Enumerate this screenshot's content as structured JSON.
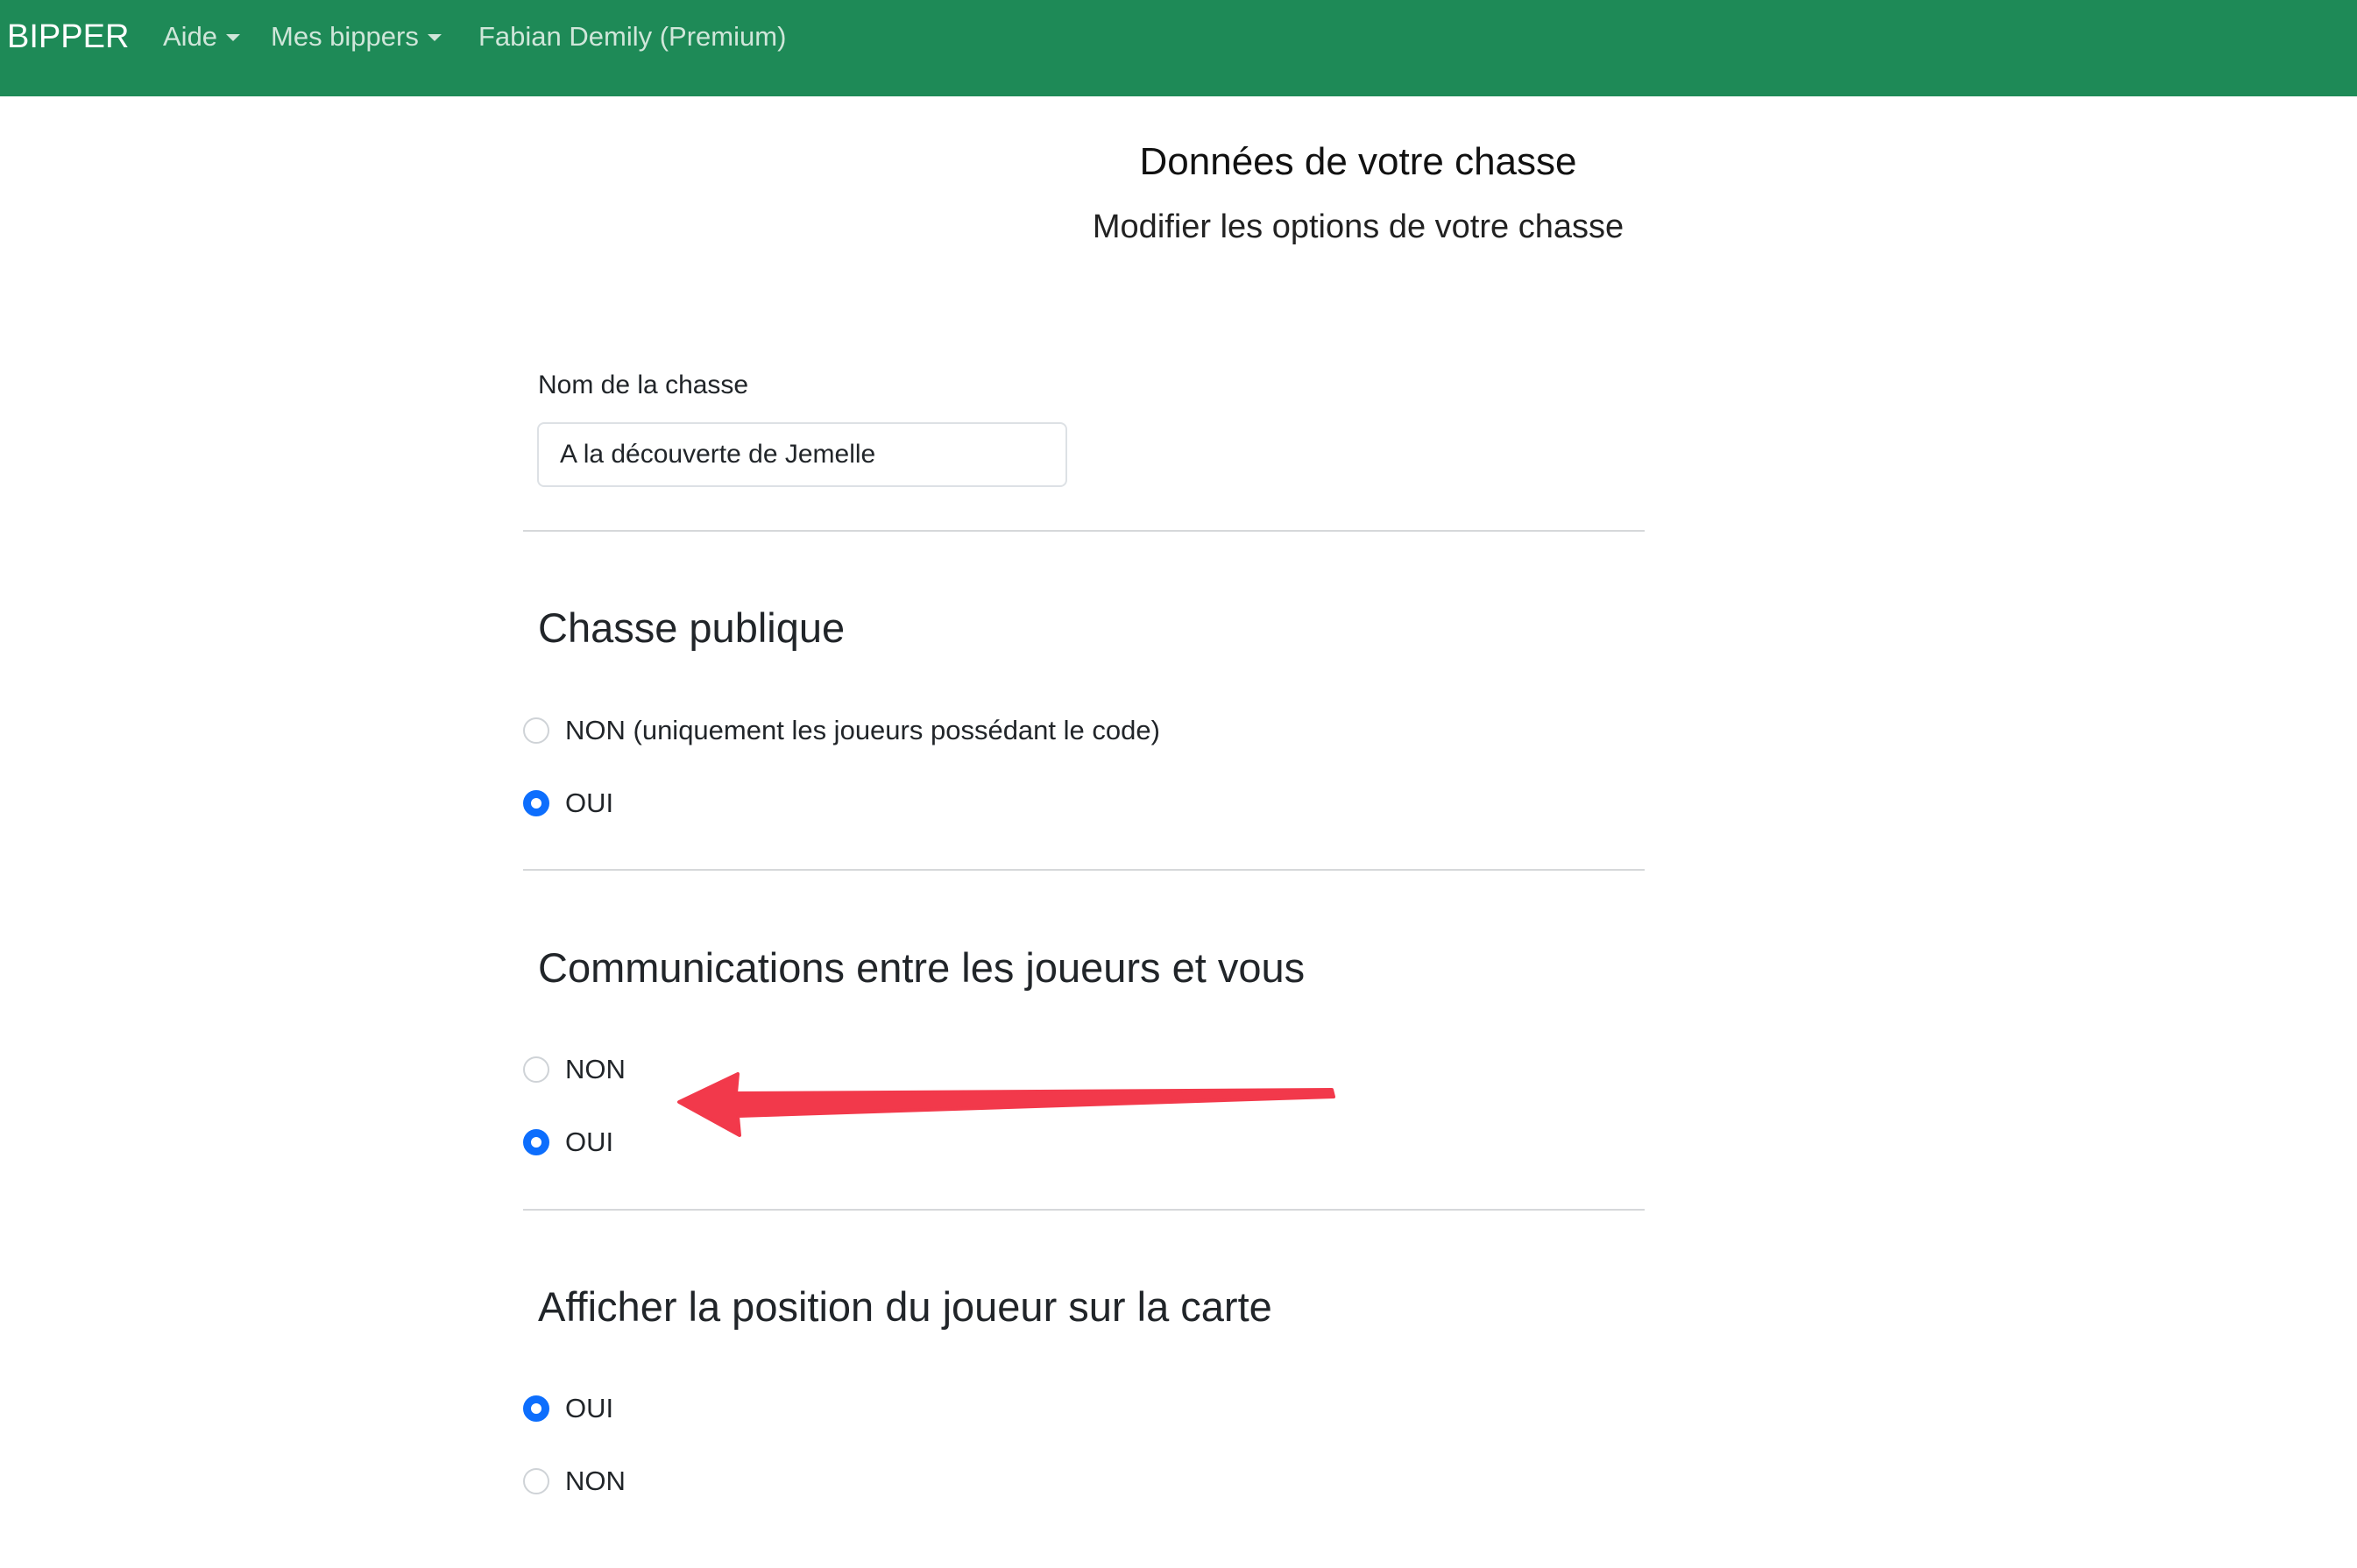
{
  "navbar": {
    "brand": "BIPPER",
    "links": [
      {
        "label": "Aide",
        "dropdown": true
      },
      {
        "label": "Mes bippers",
        "dropdown": true
      },
      {
        "label": "Fabian Demily (Premium)",
        "dropdown": false
      }
    ],
    "background_color": "#1e8a57"
  },
  "header": {
    "title": "Données de votre chasse",
    "subtitle": "Modifier les options de votre chasse"
  },
  "form": {
    "name_label": "Nom de la chasse",
    "name_value": "A la découverte de Jemelle",
    "sections": [
      {
        "title": "Chasse publique",
        "options": [
          {
            "label": "NON (uniquement les joueurs possédant le code)",
            "checked": false
          },
          {
            "label": "OUI",
            "checked": true
          }
        ]
      },
      {
        "title": "Communications entre les joueurs et vous",
        "options": [
          {
            "label": "NON",
            "checked": false
          },
          {
            "label": "OUI",
            "checked": true
          }
        ]
      },
      {
        "title": "Afficher la position du joueur sur la carte",
        "options": [
          {
            "label": "OUI",
            "checked": true
          },
          {
            "label": "NON",
            "checked": false
          }
        ]
      }
    ]
  },
  "annotation": {
    "arrow_icon": "arrow-left-icon",
    "arrow_color": "#f2394b"
  },
  "accent_color": "#0d6efd"
}
